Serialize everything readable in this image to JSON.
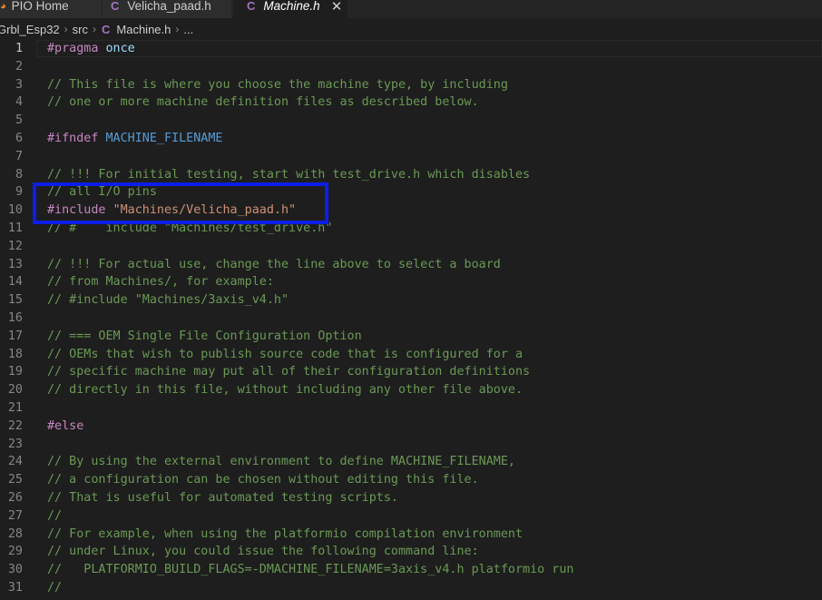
{
  "tabs": [
    {
      "label": "PIO Home",
      "icon": "platformio-icon",
      "active": false
    },
    {
      "label": "Velicha_paad.h",
      "icon": "c-file-icon",
      "active": false
    },
    {
      "label": "Machine.h",
      "icon": "c-file-icon",
      "active": true,
      "close_glyph": "✕"
    }
  ],
  "c_icon_glyph": "C",
  "breadcrumb": {
    "items": [
      "Grbl_Esp32",
      "src",
      "Machine.h",
      "..."
    ],
    "separator": "›"
  },
  "colors": {
    "highlight_box": "#0c1ee6",
    "comment": "#6a9955",
    "preprocessor": "#c586c0",
    "string": "#ce9178",
    "macro": "#569cd6"
  },
  "lines": [
    {
      "n": "1",
      "tokens": [
        [
          "preproc",
          "#pragma"
        ],
        [
          "plain",
          " "
        ],
        [
          "id",
          "once"
        ]
      ]
    },
    {
      "n": "2",
      "tokens": []
    },
    {
      "n": "3",
      "tokens": [
        [
          "comment",
          "// This file is where you choose the machine type, by including"
        ]
      ]
    },
    {
      "n": "4",
      "tokens": [
        [
          "comment",
          "// one or more machine definition files as described below."
        ]
      ]
    },
    {
      "n": "5",
      "tokens": []
    },
    {
      "n": "6",
      "tokens": [
        [
          "preproc",
          "#ifndef"
        ],
        [
          "plain",
          " "
        ],
        [
          "macro",
          "MACHINE_FILENAME"
        ]
      ]
    },
    {
      "n": "7",
      "tokens": []
    },
    {
      "n": "8",
      "tokens": [
        [
          "comment",
          "// !!! For initial testing, start with test_drive.h which disables"
        ]
      ]
    },
    {
      "n": "9",
      "tokens": [
        [
          "comment",
          "// all I/O pins"
        ]
      ]
    },
    {
      "n": "10",
      "tokens": [
        [
          "preproc",
          "#include"
        ],
        [
          "plain",
          " "
        ],
        [
          "string",
          "\"Machines/Velicha_paad.h\""
        ]
      ]
    },
    {
      "n": "11",
      "tokens": [
        [
          "comment",
          "// #    include \"Machines/test_drive.h\""
        ]
      ]
    },
    {
      "n": "12",
      "tokens": []
    },
    {
      "n": "13",
      "tokens": [
        [
          "comment",
          "// !!! For actual use, change the line above to select a board"
        ]
      ]
    },
    {
      "n": "14",
      "tokens": [
        [
          "comment",
          "// from Machines/, for example:"
        ]
      ]
    },
    {
      "n": "15",
      "tokens": [
        [
          "comment",
          "// #include \"Machines/3axis_v4.h\""
        ]
      ]
    },
    {
      "n": "16",
      "tokens": []
    },
    {
      "n": "17",
      "tokens": [
        [
          "comment",
          "// === OEM Single File Configuration Option"
        ]
      ]
    },
    {
      "n": "18",
      "tokens": [
        [
          "comment",
          "// OEMs that wish to publish source code that is configured for a"
        ]
      ]
    },
    {
      "n": "19",
      "tokens": [
        [
          "comment",
          "// specific machine may put all of their configuration definitions"
        ]
      ]
    },
    {
      "n": "20",
      "tokens": [
        [
          "comment",
          "// directly in this file, without including any other file above."
        ]
      ]
    },
    {
      "n": "21",
      "tokens": []
    },
    {
      "n": "22",
      "tokens": [
        [
          "preproc",
          "#else"
        ]
      ]
    },
    {
      "n": "23",
      "tokens": []
    },
    {
      "n": "24",
      "tokens": [
        [
          "comment",
          "// By using the external environment to define MACHINE_FILENAME,"
        ]
      ]
    },
    {
      "n": "25",
      "tokens": [
        [
          "comment",
          "// a configuration can be chosen without editing this file."
        ]
      ]
    },
    {
      "n": "26",
      "tokens": [
        [
          "comment",
          "// That is useful for automated testing scripts."
        ]
      ]
    },
    {
      "n": "27",
      "tokens": [
        [
          "comment",
          "//"
        ]
      ]
    },
    {
      "n": "28",
      "tokens": [
        [
          "comment",
          "// For example, when using the platformio compilation environment"
        ]
      ]
    },
    {
      "n": "29",
      "tokens": [
        [
          "comment",
          "// under Linux, you could issue the following command line:"
        ]
      ]
    },
    {
      "n": "30",
      "tokens": [
        [
          "comment",
          "//   PLATFORMIO_BUILD_FLAGS=-DMACHINE_FILENAME=3axis_v4.h platformio run"
        ]
      ]
    },
    {
      "n": "31",
      "tokens": [
        [
          "comment",
          "//"
        ]
      ]
    }
  ]
}
